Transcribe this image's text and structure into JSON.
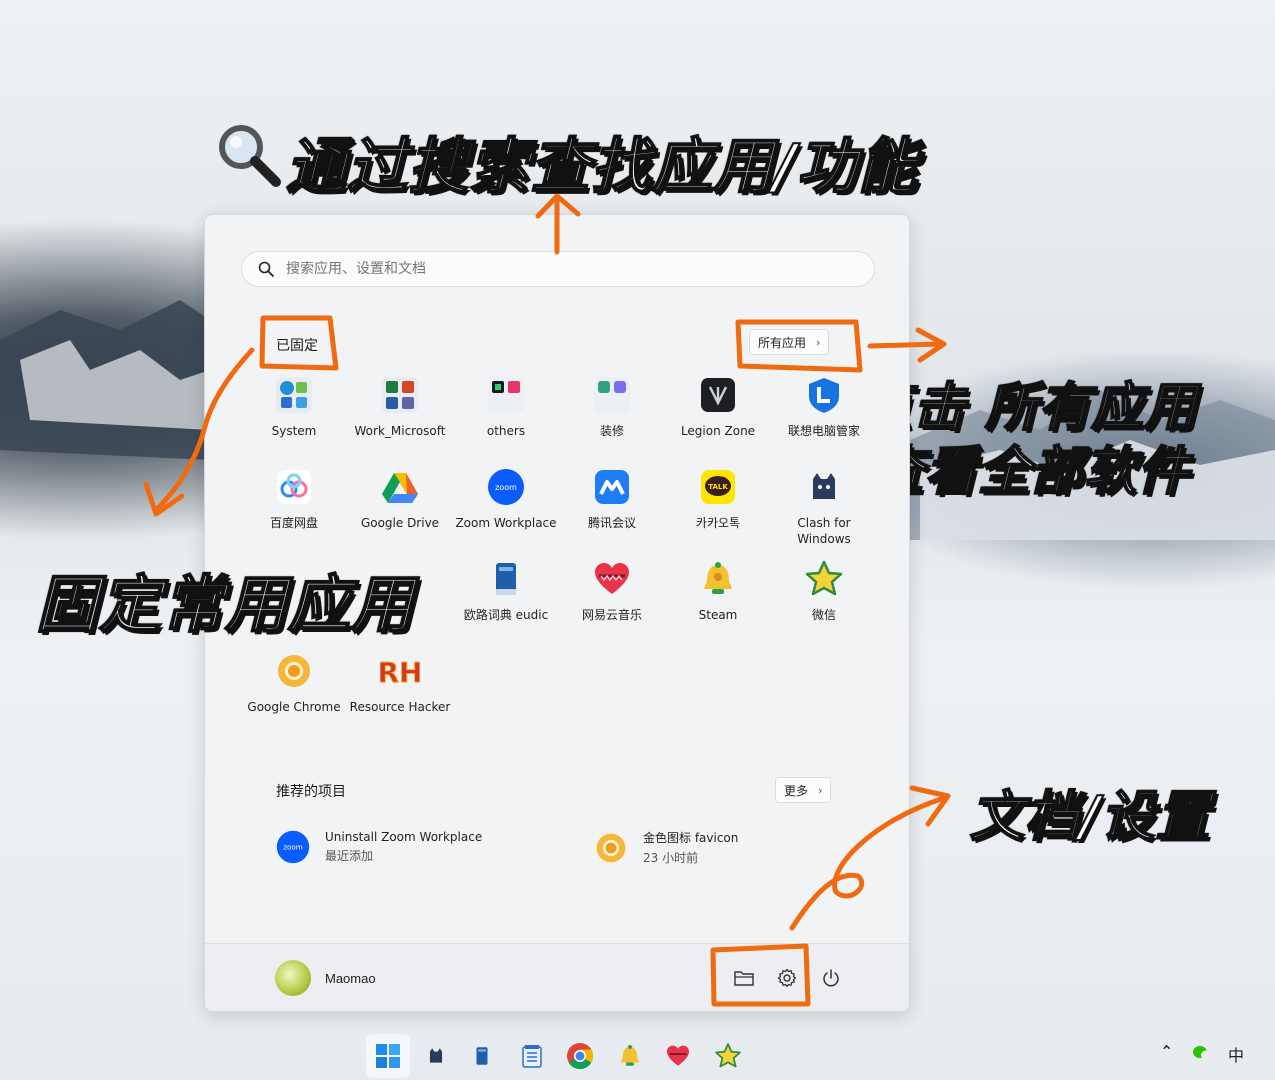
{
  "annotations": {
    "search": "通过搜索查找应用/功能",
    "all_apps_line1": "点击 所有应用",
    "all_apps_line2": "查看全部软件",
    "pinned": "固定常用应用",
    "docs_settings": "文档/设置"
  },
  "search": {
    "placeholder": "搜索应用、设置和文档"
  },
  "pinned": {
    "title": "已固定",
    "all_apps_label": "所有应用",
    "apps": [
      {
        "label": "System",
        "icon": "system-folder-icon"
      },
      {
        "label": "Work_Microsoft",
        "icon": "office-folder-icon"
      },
      {
        "label": "others",
        "icon": "others-folder-icon"
      },
      {
        "label": "装修",
        "icon": "renovation-folder-icon"
      },
      {
        "label": "Legion Zone",
        "icon": "legion-zone-icon"
      },
      {
        "label": "联想电脑管家",
        "icon": "lenovo-pc-manager-icon"
      },
      {
        "label": "百度网盘",
        "icon": "baidu-netdisk-icon"
      },
      {
        "label": "Google Drive",
        "icon": "google-drive-icon"
      },
      {
        "label": "Zoom Workplace",
        "icon": "zoom-icon"
      },
      {
        "label": "腾讯会议",
        "icon": "tencent-meeting-icon"
      },
      {
        "label": "카카오톡",
        "icon": "kakaotalk-icon"
      },
      {
        "label": "Clash for Windows",
        "icon": "clash-icon"
      },
      {
        "label": "欧路词典 eudic",
        "icon": "eudic-icon"
      },
      {
        "label": "网易云音乐",
        "icon": "netease-music-icon"
      },
      {
        "label": "Steam",
        "icon": "steam-icon"
      },
      {
        "label": "微信",
        "icon": "wechat-star-icon"
      },
      {
        "label": "Google Chrome",
        "icon": "chrome-icon"
      },
      {
        "label": "Resource Hacker",
        "icon": "resource-hacker-icon"
      }
    ]
  },
  "recommended": {
    "title": "推荐的项目",
    "more_label": "更多",
    "items": [
      {
        "title": "Uninstall Zoom Workplace",
        "subtitle": "最近添加",
        "icon": "zoom-icon"
      },
      {
        "title": "金色图标 favicon",
        "subtitle": "23 小时前",
        "icon": "chrome-icon"
      }
    ]
  },
  "footer": {
    "user_name": "Maomao"
  },
  "taskbar": {
    "ime_label": "中"
  },
  "colors": {
    "annotation_orange": "#f06a12",
    "menu_bg": "#f2f3f5",
    "accent_blue": "#0a6cd6"
  }
}
